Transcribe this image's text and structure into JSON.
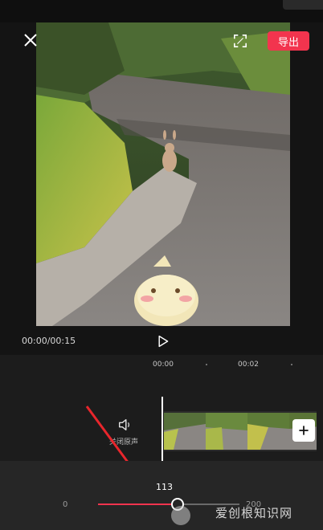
{
  "header": {
    "export_label": "导出",
    "close_icon": "close-icon",
    "fullscreen_icon": "fullscreen-icon"
  },
  "player": {
    "timecode": "00:00/00:15",
    "play_icon": "play-icon"
  },
  "timeline": {
    "ruler": [
      "00:00",
      "00:02"
    ],
    "mute_label": "关闭原声",
    "add_clip_icon": "plus-icon"
  },
  "speed_slider": {
    "value": "113",
    "min": "0",
    "max": "200",
    "fraction": 0.565
  },
  "colors": {
    "accent": "#f2344e",
    "background": "#141414"
  },
  "watermark": "爱创根知识网"
}
